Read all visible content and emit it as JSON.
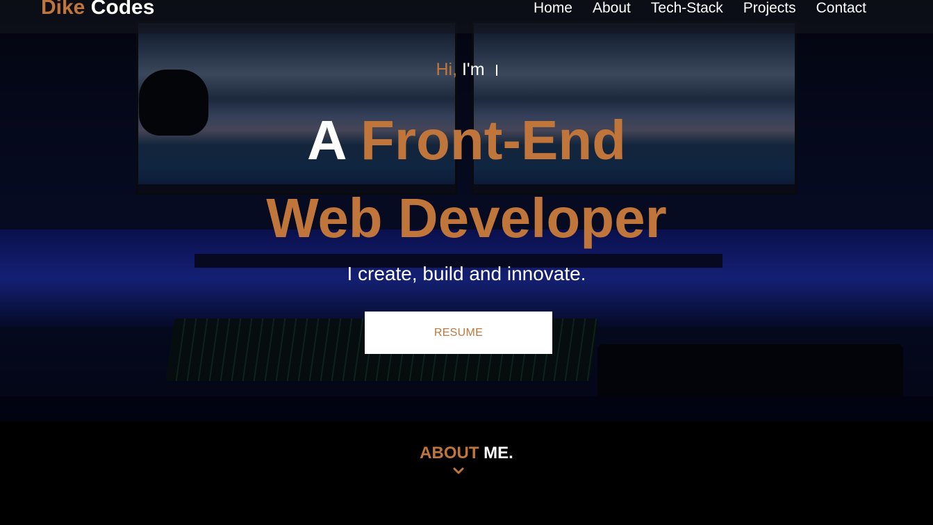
{
  "brand": {
    "part1": "Dike",
    "part2": "Codes"
  },
  "nav": {
    "items": [
      {
        "label": "Home"
      },
      {
        "label": "About"
      },
      {
        "label": "Tech-Stack"
      },
      {
        "label": "Projects"
      },
      {
        "label": "Contact"
      }
    ]
  },
  "hero": {
    "greeting_accent": "Hi,",
    "greeting_rest": "I'm",
    "headline_prefix": "A",
    "headline_line1": "Front-End",
    "headline_line2": "Web Developer",
    "tagline": "I create, build and innovate.",
    "resume_label": "RESUME"
  },
  "about": {
    "title_accent": "ABOUT",
    "title_rest": "ME."
  },
  "colors": {
    "accent": "#c0763a",
    "text": "#ffffff",
    "background": "#000000"
  },
  "icons": {
    "scroll": "chevron-down-icon"
  }
}
